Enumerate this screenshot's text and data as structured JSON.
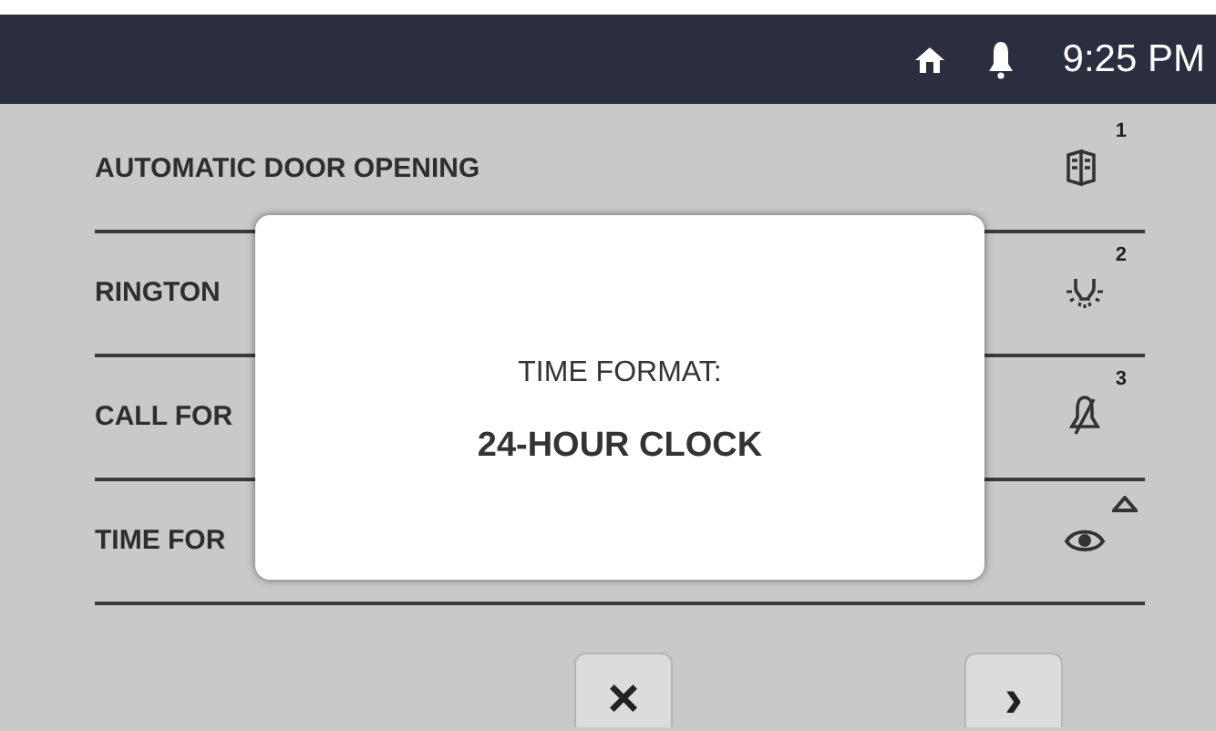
{
  "status_bar": {
    "time": "9:25 PM"
  },
  "settings": [
    {
      "label": "AUTOMATIC DOOR OPENING",
      "badge": "1"
    },
    {
      "label": "RINGTON",
      "badge": "2"
    },
    {
      "label": "CALL FOR",
      "badge": "3"
    },
    {
      "label": "TIME FOR"
    }
  ],
  "dialog": {
    "title": "TIME FORMAT:",
    "value": "24-HOUR CLOCK"
  },
  "buttons": [
    {
      "kind": "close",
      "label": "×"
    },
    {
      "kind": "next",
      "label": "›"
    }
  ]
}
